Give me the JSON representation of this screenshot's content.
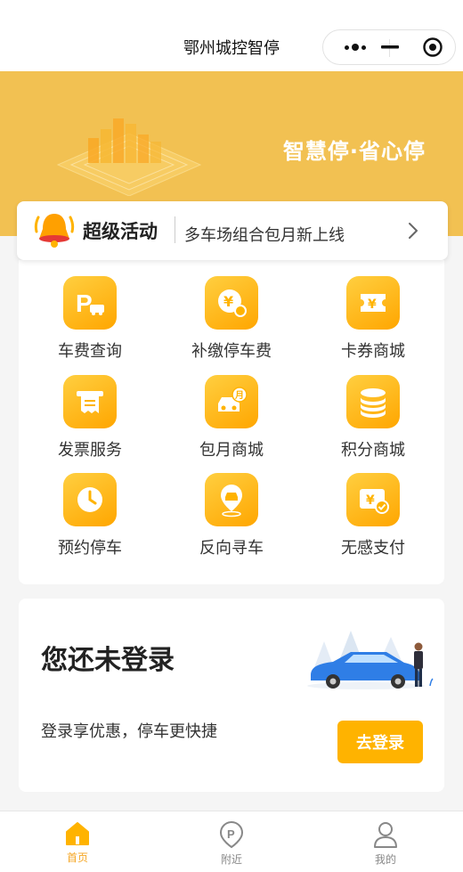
{
  "nav": {
    "title": "鄂州城控智停"
  },
  "banner": {
    "slogan": "智慧停·省心停"
  },
  "promo": {
    "title": "超级活动",
    "text": "多车场组合包月新上线"
  },
  "services": [
    {
      "label": "车费查询",
      "icon": "parking-fee-icon"
    },
    {
      "label": "补缴停车费",
      "icon": "yuan-coin-icon"
    },
    {
      "label": "卡券商城",
      "icon": "coupon-icon"
    },
    {
      "label": "发票服务",
      "icon": "invoice-icon"
    },
    {
      "label": "包月商城",
      "icon": "monthly-pass-icon"
    },
    {
      "label": "积分商城",
      "icon": "points-coins-icon"
    },
    {
      "label": "预约停车",
      "icon": "clock-icon"
    },
    {
      "label": "反向寻车",
      "icon": "find-car-icon"
    },
    {
      "label": "无感支付",
      "icon": "auto-pay-icon"
    }
  ],
  "login": {
    "title": "您还未登录",
    "subtitle": "登录享优惠，停车更快捷",
    "button": "去登录"
  },
  "tabbar": [
    {
      "label": "首页",
      "active": true
    },
    {
      "label": "附近",
      "active": false
    },
    {
      "label": "我的",
      "active": false
    }
  ],
  "colors": {
    "accent": "#ffb300",
    "banner": "#f2c152",
    "tab_active": "#f5a623"
  }
}
